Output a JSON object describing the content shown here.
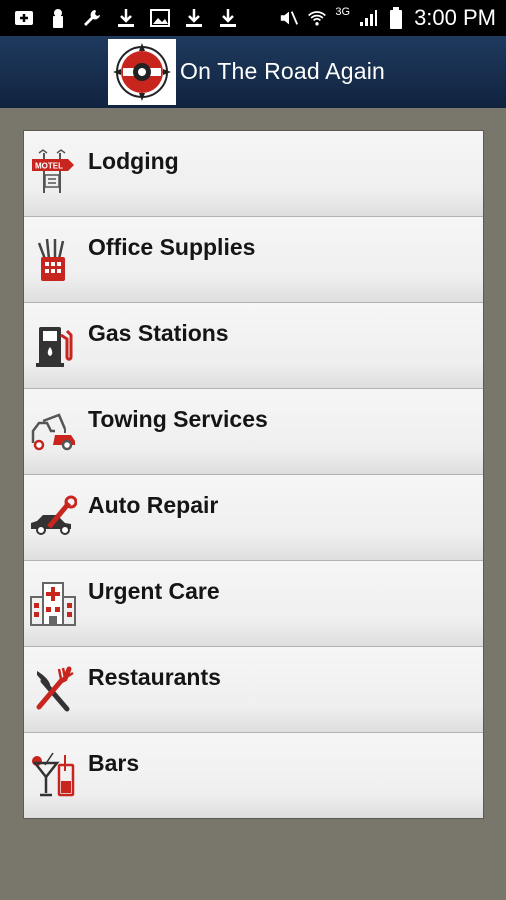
{
  "status_bar": {
    "time": "3:00 PM",
    "network": "3G",
    "icons": [
      "add-icon",
      "lock-icon",
      "wrench-icon",
      "download-icon",
      "image-icon",
      "download-icon",
      "download-icon",
      "mute-icon",
      "wifi-icon",
      "signal-icon",
      "battery-icon"
    ]
  },
  "header": {
    "title": "On The Road Again",
    "logo": "compass-logo"
  },
  "menu": {
    "items": [
      {
        "label": "Lodging",
        "icon": "motel-sign-icon"
      },
      {
        "label": "Office Supplies",
        "icon": "pencil-cup-icon"
      },
      {
        "label": "Gas Stations",
        "icon": "gas-pump-icon"
      },
      {
        "label": "Towing Services",
        "icon": "tow-truck-icon"
      },
      {
        "label": "Auto Repair",
        "icon": "car-wrench-icon"
      },
      {
        "label": "Urgent Care",
        "icon": "hospital-icon"
      },
      {
        "label": "Restaurants",
        "icon": "fork-knife-icon"
      },
      {
        "label": "Bars",
        "icon": "cocktail-icon"
      }
    ]
  },
  "colors": {
    "accent": "#c0392b",
    "header_bg": "#1a3152",
    "page_bg": "#79766b"
  }
}
